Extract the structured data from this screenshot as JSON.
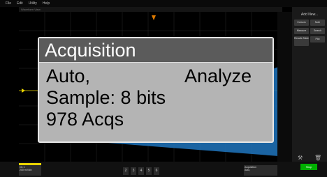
{
  "menu": {
    "file": "File",
    "edit": "Edit",
    "utility": "Utility",
    "help": "Help"
  },
  "window_title": "Waveform View",
  "side_panel": {
    "add_new": "Add New...",
    "buttons": [
      "Cursors",
      "Note",
      "Measure",
      "Search",
      "Results Table",
      "Plot"
    ]
  },
  "callout": {
    "title": "Acquisition",
    "mode": "Auto,",
    "analyze": "Analyze",
    "sample": "Sample: 8 bits",
    "acqs": "978 Acqs"
  },
  "bottom": {
    "ch1_label": "Ch 1",
    "ch1_detail": "200 mV/div",
    "channel_numbers": [
      "2",
      "3",
      "4",
      "5",
      "6"
    ],
    "acq_label": "Acquisition",
    "acq_line1": "Auto,",
    "acq_line2": "Analyze",
    "acq_line3": "Sample: 8 bits",
    "run_label": "Stop"
  },
  "colors": {
    "ch1": "#e9d300",
    "run": "#00b000",
    "blue_wedge": "#1e6fb4"
  }
}
